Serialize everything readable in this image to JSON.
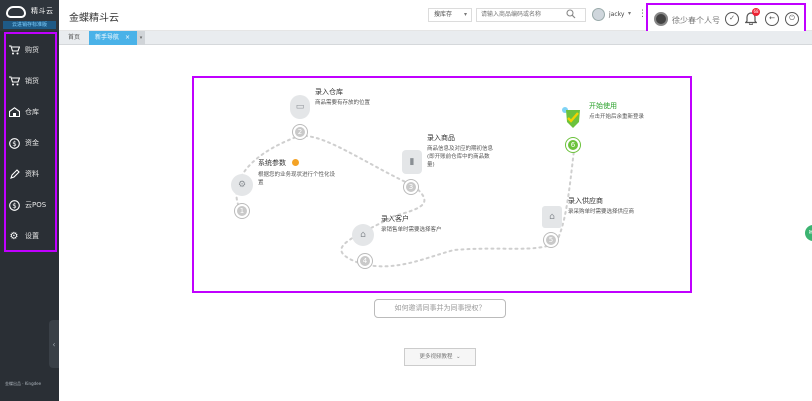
{
  "app": {
    "logo_text": "精斗云",
    "logo_sub": "云进销存标准版",
    "title": "金蝶精斗云",
    "footer": "金蝶出品 · Kingdee"
  },
  "sidebar": {
    "items": [
      {
        "label": "购货",
        "icon": "cart-icon"
      },
      {
        "label": "销货",
        "icon": "sales-cart-icon"
      },
      {
        "label": "仓库",
        "icon": "warehouse-icon"
      },
      {
        "label": "资金",
        "icon": "money-icon"
      },
      {
        "label": "资料",
        "icon": "pen-icon"
      },
      {
        "label": "云POS",
        "icon": "pos-icon"
      },
      {
        "label": "设置",
        "icon": "gear-icon"
      }
    ]
  },
  "topbar": {
    "search_type": "搜库存",
    "search_placeholder": "请输入商品编码或名称",
    "username": "jacky",
    "profile_label": "徐少春个人号",
    "notification_count": "68"
  },
  "tabs": {
    "home": "首页",
    "active": "新手导航",
    "close": "×"
  },
  "guide": {
    "steps": [
      {
        "num": "1",
        "title": "系统参数",
        "desc": "根据您的业务现状进行个性化设置"
      },
      {
        "num": "2",
        "title": "录入仓库",
        "desc": "商品需要有存放的位置"
      },
      {
        "num": "3",
        "title": "录入商品",
        "desc": "商品信息及对应的期初信息(即开账前仓库中的商品数量)"
      },
      {
        "num": "4",
        "title": "录入客户",
        "desc": "录销售单时需要选择客户"
      },
      {
        "num": "5",
        "title": "录入供应商",
        "desc": "录采购单时需要选择供应商"
      },
      {
        "num": "6",
        "title": "开始使用",
        "desc": "点击开始后余重新登录"
      }
    ]
  },
  "actions": {
    "invite": "如何邀请同事并为同事授权？",
    "more_videos": "更多视频教程"
  },
  "colors": {
    "sidebar_bg": "#2a2f35",
    "accent_blue": "#4ab2e8",
    "accent_green": "#6cc23c",
    "highlight_border": "#c000ff"
  }
}
